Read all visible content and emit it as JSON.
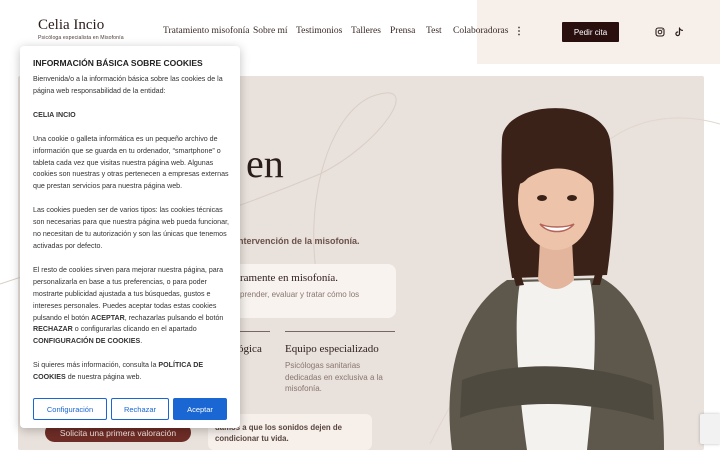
{
  "header": {
    "logo_name": "Celia Incio",
    "logo_subtitle": "Psicóloga especialista en Misofonía",
    "nav": [
      {
        "label": "Tratamiento misofonía"
      },
      {
        "label": "Sobre mí"
      },
      {
        "label": "Testimonios"
      },
      {
        "label": "Talleres"
      },
      {
        "label": "Prensa"
      },
      {
        "label": "Test"
      },
      {
        "label": "Colaboradoras"
      }
    ],
    "more_icon": "⋮",
    "cta_label": "Pedir cita",
    "social_icons": [
      "instagram-icon",
      "tiktok-icon"
    ]
  },
  "hero": {
    "heading_fragment": "en",
    "subtitle_fragment": "ntervención de la misofonía.",
    "card1": {
      "title": "ramente en misofonía.",
      "body": "prender, evaluar y tratar cómo los"
    },
    "feature1_title": "ógica",
    "feature2": {
      "title": "Equipo especializado",
      "body": "Psicólogas sanitarias dedicadas en exclusiva a la misofonía."
    },
    "card2_text": "damos a que los sonidos dejen de condicionar tu vida.",
    "button_label": "Solicita una primera valoración"
  },
  "cookie_banner": {
    "title": "INFORMACIÓN BÁSICA SOBRE COOKIES",
    "p1": "Bienvenida/o a la información básica sobre las cookies de la página web responsabilidad de la entidad:",
    "entity": "CELIA INCIO",
    "p2": "Una cookie o galleta informática es un pequeño archivo de información que se guarda en tu ordenador, “smartphone” o tableta cada vez que visitas nuestra página web. Algunas cookies son nuestras y otras pertenecen a empresas externas que prestan servicios para nuestra página web.",
    "p3": "Las cookies pueden ser de varios tipos: las cookies técnicas son necesarias para que nuestra página web pueda funcionar, no necesitan de tu autorización y son las únicas que tenemos activadas por defecto.",
    "p4_a": "El resto de cookies sirven para mejorar nuestra página, para personalizarla en base a tus preferencias, o para poder mostrarte publicidad ajustada a tus búsquedas, gustos e intereses personales. Puedes aceptar todas estas cookies pulsando el botón ",
    "p4_accept": "ACEPTAR",
    "p4_b": ", rechazarlas pulsando el botón ",
    "p4_reject": "RECHAZAR",
    "p4_c": " o configurarlas clicando en el apartado ",
    "p4_config": "CONFIGURACIÓN DE COOKIES",
    "p4_d": ".",
    "p5_a": "Si quieres más información, consulta la ",
    "p5_policy": "POLÍTICA DE COOKIES",
    "p5_b": " de nuestra página web.",
    "btn_config": "Configuración",
    "btn_reject": "Rechazar",
    "btn_accept": "Aceptar"
  },
  "colors": {
    "accent_blue": "#1a66d2",
    "cta_dark": "#2a0f0f",
    "hero_button": "#6e2c26",
    "panel_beige": "#e9e1db"
  }
}
